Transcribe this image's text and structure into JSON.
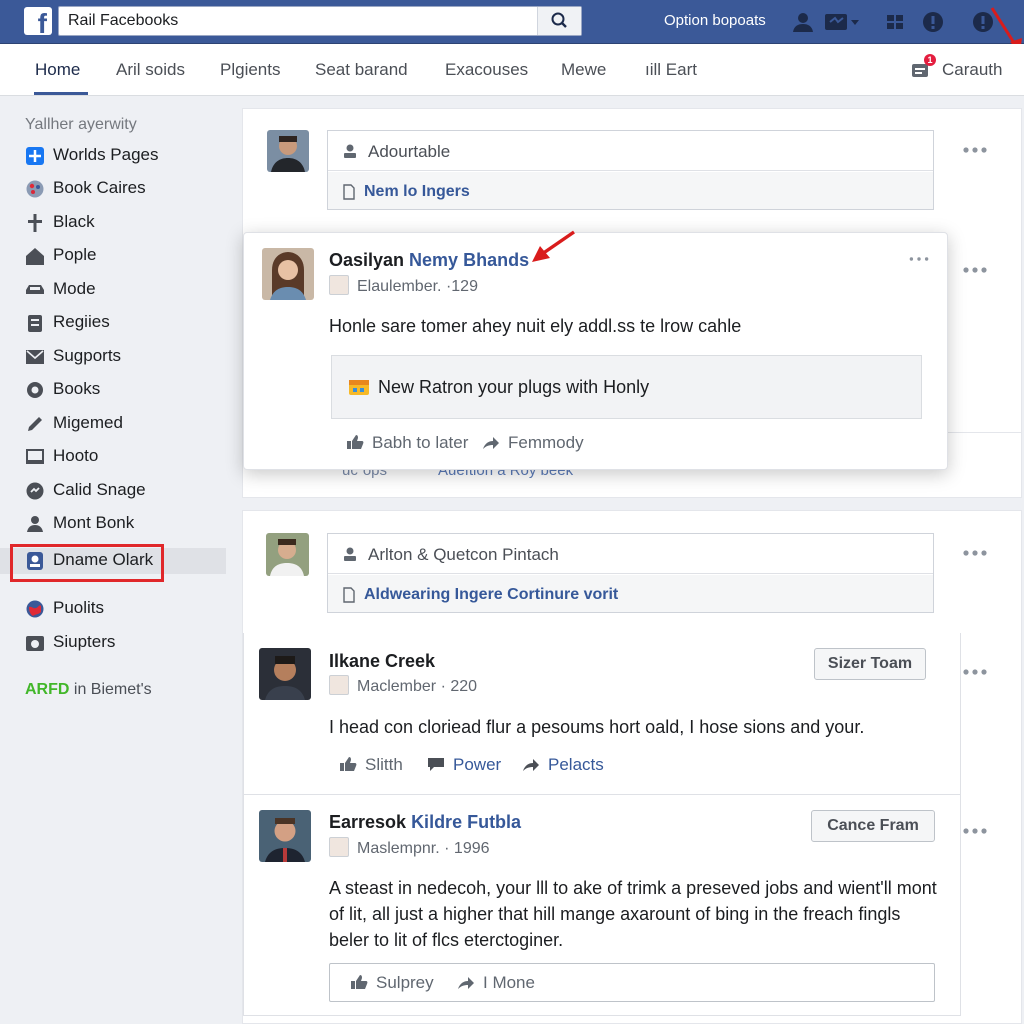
{
  "topbar": {
    "search": {
      "value": "Rail Facebooks"
    },
    "link": "Option bopoats",
    "logo": "f"
  },
  "nav": {
    "tabs": [
      {
        "label": "Home",
        "active": true
      },
      {
        "label": "Aril soids"
      },
      {
        "label": "Plgients"
      },
      {
        "label": "Seat barand"
      },
      {
        "label": "Exacouses"
      },
      {
        "label": "Mewe"
      },
      {
        "label": "ıill Eart"
      }
    ],
    "notifications": {
      "label": "Carauth",
      "badge": "1"
    }
  },
  "sidebar": {
    "heading": "Yallher ayerwity",
    "items": [
      {
        "label": "Worlds Pages",
        "icon": "flag-icon"
      },
      {
        "label": "Book Caires",
        "icon": "palette-icon"
      },
      {
        "label": "Black",
        "icon": "pin-icon"
      },
      {
        "label": "Pople",
        "icon": "home-icon"
      },
      {
        "label": "Mode",
        "icon": "car-icon"
      },
      {
        "label": "Regiies",
        "icon": "clipboard-icon"
      },
      {
        "label": "Sugports",
        "icon": "mail-icon"
      },
      {
        "label": "Books",
        "icon": "gear-icon"
      },
      {
        "label": "Migemed",
        "icon": "pencil-icon"
      },
      {
        "label": "Hooto",
        "icon": "monitor-icon"
      },
      {
        "label": "Calid Snage",
        "icon": "chat-icon"
      },
      {
        "label": "Mont Bonk",
        "icon": "person-icon"
      },
      {
        "label": "Dname Olark",
        "icon": "profile-icon",
        "selected": true
      },
      {
        "label": "Puolits",
        "icon": "globe-icon"
      },
      {
        "label": "Siupters",
        "icon": "camera-icon"
      }
    ],
    "footer_brand": "ARFD",
    "footer_text": " in Biemet's"
  },
  "feed": {
    "composer1": {
      "placeholder": "Adourtable",
      "link": "Nem lo Ingers"
    },
    "post1": {
      "name": "Oasilyan ",
      "name_link": "Nemy Bhands",
      "meta": "Elaulember. ·129",
      "body": "Honle sare tomer ahey nuit ely addl.ss te lrow cahle",
      "attachment": "New Ratron your plugs with Honly",
      "actions": [
        "Babh to later",
        "Femmody"
      ]
    },
    "ghost_actions": [
      "¨uc¨ops",
      "Aueftion a Roy beek"
    ],
    "composer2": {
      "placeholder": "Arlton & Quetcon Pintach",
      "link": "Aldwearing Ingere Cortinure vorit"
    },
    "post2": {
      "name": "Ilkane Creek",
      "meta": "Maclember · 220",
      "body": "I head con cloriead flur a pesoums hort oald, I hose sions and your.",
      "button": "Sizer Toam",
      "actions": [
        "Slitth",
        "Power",
        "Pelacts"
      ]
    },
    "post3": {
      "name": "Earresok ",
      "name_link": "Kildre Futbla",
      "meta": "Maslempnr. · 1996",
      "body": "A steast in nedecoh, your lll to ake of trimk a preseved jobs and wient'll mont of lit, all just a higher that hill mange axarount of bing in the freach fingls beler to lit of flcs eterctoginer.",
      "button": "Cance Fram",
      "actions": [
        "Sulprey",
        "I Mone"
      ]
    }
  },
  "colors": {
    "brand": "#3b5998",
    "link": "#365899",
    "highlight": "#e0272a"
  }
}
